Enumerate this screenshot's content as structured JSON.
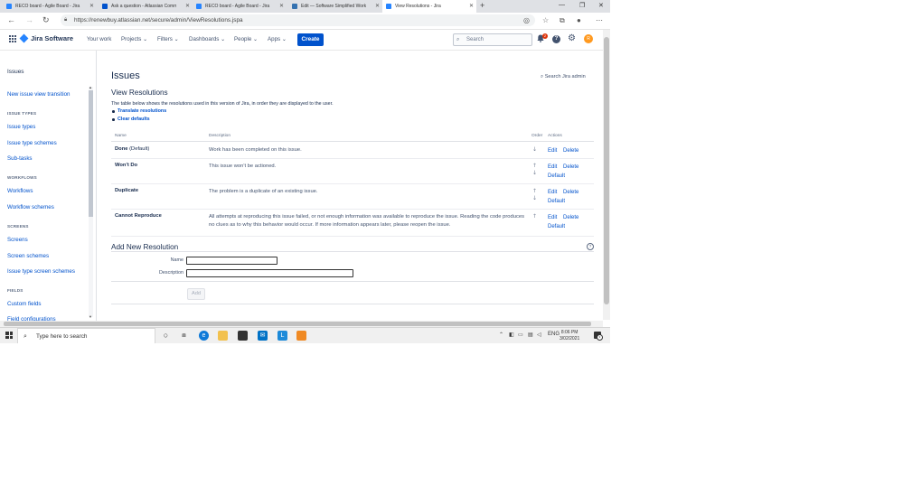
{
  "browser": {
    "tabs": [
      {
        "title": "RECO board - Agile Board - Jira",
        "active": false,
        "color": "#2684ff"
      },
      {
        "title": "Ask a question - Atlassian Comm",
        "active": false,
        "color": "#0052cc"
      },
      {
        "title": "RECO board - Agile Board - Jira",
        "active": false,
        "color": "#2684ff"
      },
      {
        "title": "Edit — Software Simplified Work",
        "active": false,
        "color": "#3572b0"
      },
      {
        "title": "View Resolutions - Jira",
        "active": true,
        "color": "#2684ff"
      }
    ],
    "url": "https://renewbuy.atlassian.net/secure/admin/ViewResolutions.jspa"
  },
  "header": {
    "product": "Jira Software",
    "menu": [
      "Your work",
      "Projects",
      "Filters",
      "Dashboards",
      "People",
      "Apps"
    ],
    "create_label": "Create",
    "search_placeholder": "Search",
    "notifications_count": "2",
    "avatar_initial": "R"
  },
  "sidebar": {
    "heading": "Issues",
    "items": [
      {
        "type": "link",
        "label": "New issue view transition"
      },
      {
        "type": "head",
        "label": "ISSUE TYPES"
      },
      {
        "type": "link",
        "label": "Issue types"
      },
      {
        "type": "link",
        "label": "Issue type schemes"
      },
      {
        "type": "link",
        "label": "Sub-tasks"
      },
      {
        "type": "head",
        "label": "WORKFLOWS"
      },
      {
        "type": "link",
        "label": "Workflows"
      },
      {
        "type": "link",
        "label": "Workflow schemes"
      },
      {
        "type": "head",
        "label": "SCREENS"
      },
      {
        "type": "link",
        "label": "Screens"
      },
      {
        "type": "link",
        "label": "Screen schemes"
      },
      {
        "type": "link",
        "label": "Issue type screen schemes"
      },
      {
        "type": "head",
        "label": "FIELDS"
      },
      {
        "type": "link",
        "label": "Custom fields"
      },
      {
        "type": "link",
        "label": "Field configurations"
      }
    ]
  },
  "main": {
    "title": "Issues",
    "admin_search": "Search Jira admin",
    "subtitle": "View Resolutions",
    "intro": "The table below shows the resolutions used in this version of Jira, in order they are displayed to the user.",
    "link_translate_bold": "Translate",
    "link_translate_rest": " resolutions",
    "link_clear": "Clear defaults",
    "columns": [
      "Name",
      "Description",
      "Order",
      "Actions"
    ],
    "rows": [
      {
        "name": "Done",
        "default_tag": " (Default)",
        "description": "Work has been completed on this issue.",
        "up": false,
        "down": true,
        "edit": "Edit",
        "delete": "Delete",
        "default_link": ""
      },
      {
        "name": "Won't Do",
        "default_tag": "",
        "description": "This issue won't be actioned.",
        "up": true,
        "down": true,
        "edit": "Edit",
        "delete": "Delete",
        "default_link": "Default"
      },
      {
        "name": "Duplicate",
        "default_tag": "",
        "description": "The problem is a duplicate of an existing issue.",
        "up": true,
        "down": true,
        "edit": "Edit",
        "delete": "Delete",
        "default_link": "Default"
      },
      {
        "name": "Cannot Reproduce",
        "default_tag": "",
        "description": "All attempts at reproducing this issue failed, or not enough information was available to reproduce the issue. Reading the code produces no clues as to why this behavior would occur. If more information appears later, please reopen the issue.",
        "up": true,
        "down": false,
        "edit": "Edit",
        "delete": "Delete",
        "default_link": "Default"
      }
    ],
    "add_title": "Add New Resolution",
    "name_label": "Name",
    "description_label": "Description",
    "add_button": "Add"
  },
  "taskbar": {
    "search_text": "Type here to search",
    "language": "ENG",
    "time": "8:06 PM",
    "date": "3/02/2021",
    "notification_count": "3"
  }
}
